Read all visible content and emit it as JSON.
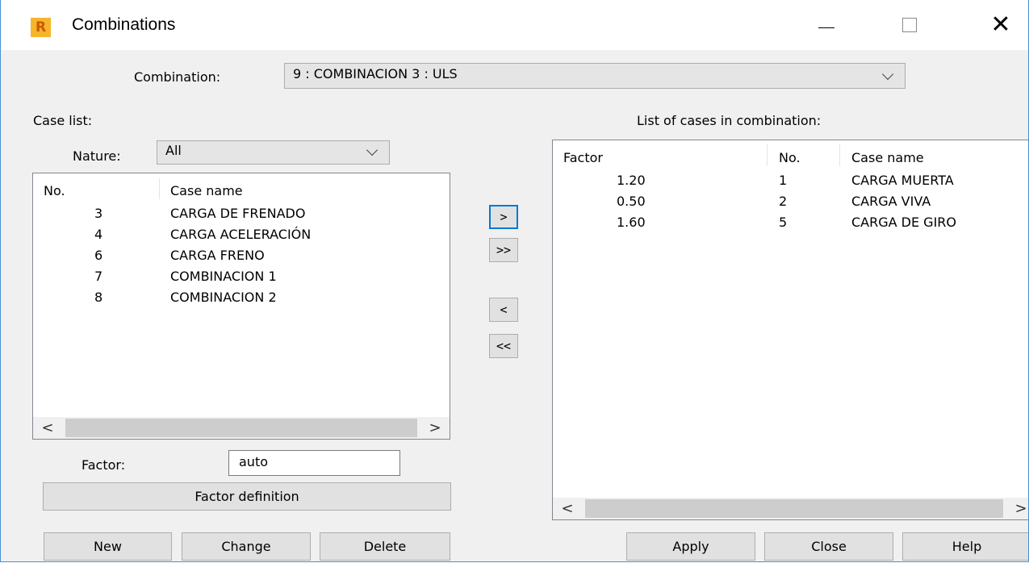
{
  "window": {
    "title": "Combinations",
    "icon_letter": "R",
    "controls": {
      "minimize": "—",
      "close": "✕"
    }
  },
  "combination": {
    "label": "Combination:",
    "selected": "9 : COMBINACION 3 : ULS"
  },
  "case_list": {
    "title": "Case list:",
    "nature_label": "Nature:",
    "nature_selected": "All",
    "columns": [
      "No.",
      "Case name"
    ],
    "rows": [
      {
        "no": "3",
        "name": "CARGA DE FRENADO"
      },
      {
        "no": "4",
        "name": "CARGA ACELERACIÓN"
      },
      {
        "no": "6",
        "name": "CARGA FRENO"
      },
      {
        "no": "7",
        "name": "COMBINACION 1"
      },
      {
        "no": "8",
        "name": "COMBINACION 2"
      }
    ],
    "factor_label": "Factor:",
    "factor_value": "auto",
    "factor_definition_button": "Factor definition"
  },
  "move_buttons": {
    "add": ">",
    "add_all": ">>",
    "remove": "<",
    "remove_all": "<<"
  },
  "combination_cases": {
    "title": "List of cases in combination:",
    "columns": [
      "Factor",
      "No.",
      "Case name"
    ],
    "rows": [
      {
        "factor": "1.20",
        "no": "1",
        "name": "CARGA MUERTA"
      },
      {
        "factor": "0.50",
        "no": "2",
        "name": "CARGA VIVA"
      },
      {
        "factor": "1.60",
        "no": "5",
        "name": "CARGA DE GIRO"
      }
    ]
  },
  "buttons": {
    "new": "New",
    "change": "Change",
    "delete": "Delete",
    "apply": "Apply",
    "close": "Close",
    "help": "Help"
  },
  "scroll_arrows": {
    "left": "<",
    "right": ">"
  }
}
